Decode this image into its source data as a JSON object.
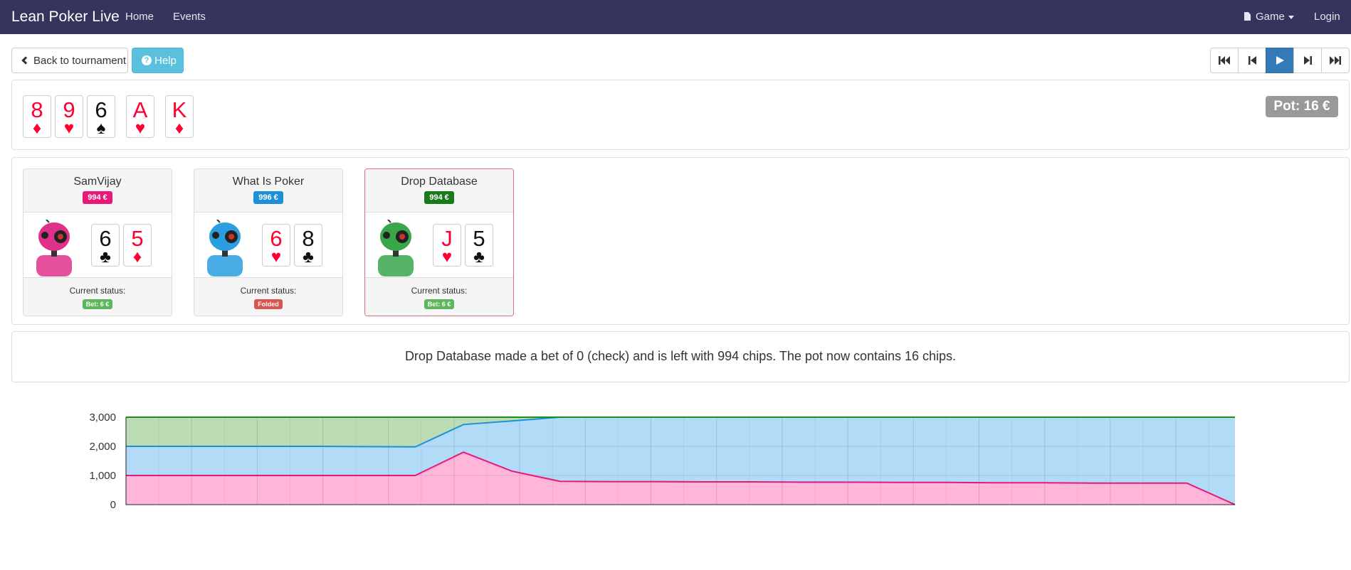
{
  "nav": {
    "brand": "Lean Poker Live",
    "home": "Home",
    "events": "Events",
    "game": "Game",
    "login": "Login"
  },
  "toolbar": {
    "back_label": "Back to tournament",
    "help_label": "Help",
    "playback_icons": [
      "skip-to-start-icon",
      "step-back-icon",
      "play-icon",
      "step-forward-icon",
      "skip-to-end-icon"
    ]
  },
  "board": {
    "cards": [
      {
        "rank": "8",
        "suit": "♦",
        "color": "red"
      },
      {
        "rank": "9",
        "suit": "♥",
        "color": "red"
      },
      {
        "rank": "6",
        "suit": "♠",
        "color": "black"
      },
      {
        "rank": "A",
        "suit": "♥",
        "color": "red"
      },
      {
        "rank": "K",
        "suit": "♦",
        "color": "red"
      }
    ],
    "pot": "Pot: 16 €"
  },
  "players": [
    {
      "name": "SamVijay",
      "chips": "994 €",
      "chip_color": "#e8177a",
      "avatar_color": "#e0318a",
      "cards": [
        {
          "rank": "6",
          "suit": "♣",
          "color": "black"
        },
        {
          "rank": "5",
          "suit": "♦",
          "color": "red"
        }
      ],
      "status_label": "Current status:",
      "status": "Bet: 6 €",
      "status_color": "#5cb85c",
      "active": false
    },
    {
      "name": "What Is Poker",
      "chips": "996 €",
      "chip_color": "#1e90d8",
      "avatar_color": "#2a9ee0",
      "cards": [
        {
          "rank": "6",
          "suit": "♥",
          "color": "red"
        },
        {
          "rank": "8",
          "suit": "♣",
          "color": "black"
        }
      ],
      "status_label": "Current status:",
      "status": "Folded",
      "status_color": "#d9534f",
      "active": false
    },
    {
      "name": "Drop Database",
      "chips": "994 €",
      "chip_color": "#1a7a1a",
      "avatar_color": "#3aa64a",
      "cards": [
        {
          "rank": "J",
          "suit": "♥",
          "color": "red"
        },
        {
          "rank": "5",
          "suit": "♣",
          "color": "black"
        }
      ],
      "status_label": "Current status:",
      "status": "Bet: 6 €",
      "status_color": "#5cb85c",
      "active": true
    }
  ],
  "log": {
    "message": "Drop Database made a bet of 0 (check) and is left with 994 chips. The pot now contains 16 chips."
  },
  "chart_data": {
    "type": "area",
    "stacked": true,
    "ylim": [
      0,
      3000
    ],
    "yticks": [
      "3,000",
      "2,000",
      "1,000",
      "0"
    ],
    "x": [
      0,
      1,
      2,
      3,
      4,
      5,
      6,
      7,
      8,
      9,
      10,
      11,
      12,
      13,
      14,
      15,
      16,
      17,
      18,
      19,
      20,
      21,
      22,
      23
    ],
    "series": [
      {
        "color": "#e8177a",
        "fill": "#ffb6d9",
        "values": [
          1000,
          1000,
          1000,
          1000,
          1000,
          1000,
          1000,
          1800,
          1150,
          800,
          790,
          790,
          780,
          780,
          770,
          770,
          760,
          760,
          750,
          750,
          740,
          740,
          740,
          0
        ]
      },
      {
        "color": "#1e90d8",
        "fill": "#b2dbf7",
        "values": [
          1000,
          1000,
          1000,
          1000,
          1000,
          990,
          980,
          950,
          1720,
          2200,
          2210,
          2210,
          2220,
          2220,
          2230,
          2230,
          2240,
          2240,
          2250,
          2250,
          2260,
          2260,
          2260,
          3000
        ]
      },
      {
        "color": "#1a8f1a",
        "fill": "#bbdcb4",
        "values": [
          1000,
          1000,
          1000,
          1000,
          1000,
          1010,
          1020,
          250,
          130,
          0,
          0,
          0,
          0,
          0,
          0,
          0,
          0,
          0,
          0,
          0,
          0,
          0,
          0,
          0
        ]
      }
    ]
  }
}
